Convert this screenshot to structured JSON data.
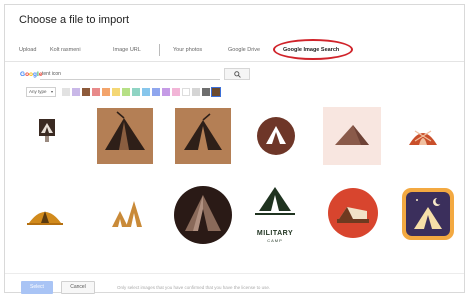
{
  "dialog": {
    "title": "Choose a file to import"
  },
  "tabs": [
    {
      "label": "Upload",
      "active": false
    },
    {
      "label": "Kolt rasmeni",
      "active": false
    },
    {
      "label": "Image URL",
      "active": false
    },
    {
      "label": "Your photos",
      "active": false
    },
    {
      "label": "Google Drive",
      "active": false
    },
    {
      "label": "Google Image Search",
      "active": true
    }
  ],
  "search": {
    "logo": "Google",
    "query": "tent icon",
    "button_icon": "search-icon"
  },
  "filters": {
    "type_label": "Any type",
    "swatch_colors": [
      "#e2e2e2",
      "#c9b8e8",
      "#8d5a3a",
      "#e88a8a",
      "#f3a46b",
      "#f4d774",
      "#b6e086",
      "#8fd4c4",
      "#87c6ec",
      "#8fa6ee",
      "#c59be6",
      "#f2b5d7",
      "#ffffff",
      "#d5d5d5",
      "#6e6e6e",
      "#6b4a2e"
    ],
    "selected_color": "#6b4a2e"
  },
  "results": [
    {
      "icon": "tent-on-sign-icon",
      "caption": ""
    },
    {
      "icon": "brown-tent-square-icon",
      "caption": ""
    },
    {
      "icon": "brown-tent-square-icon",
      "caption": ""
    },
    {
      "icon": "tent-circle-icon",
      "caption": ""
    },
    {
      "icon": "pink-tent-icon",
      "caption": ""
    },
    {
      "icon": "dome-tent-icon",
      "caption": ""
    },
    {
      "icon": "orange-tent-icon",
      "caption": ""
    },
    {
      "icon": "small-tents-icon",
      "caption": ""
    },
    {
      "icon": "night-tent-circle-icon",
      "caption": ""
    },
    {
      "icon": "military-camp-icon",
      "caption": "MILITARY",
      "subcaption": "CAMP"
    },
    {
      "icon": "red-circle-tent-icon",
      "caption": ""
    },
    {
      "icon": "tent-moon-icon",
      "caption": ""
    }
  ],
  "footer": {
    "select_label": "Select",
    "cancel_label": "Cancel",
    "note": "Only select images that you have confirmed that you have the license to use."
  }
}
